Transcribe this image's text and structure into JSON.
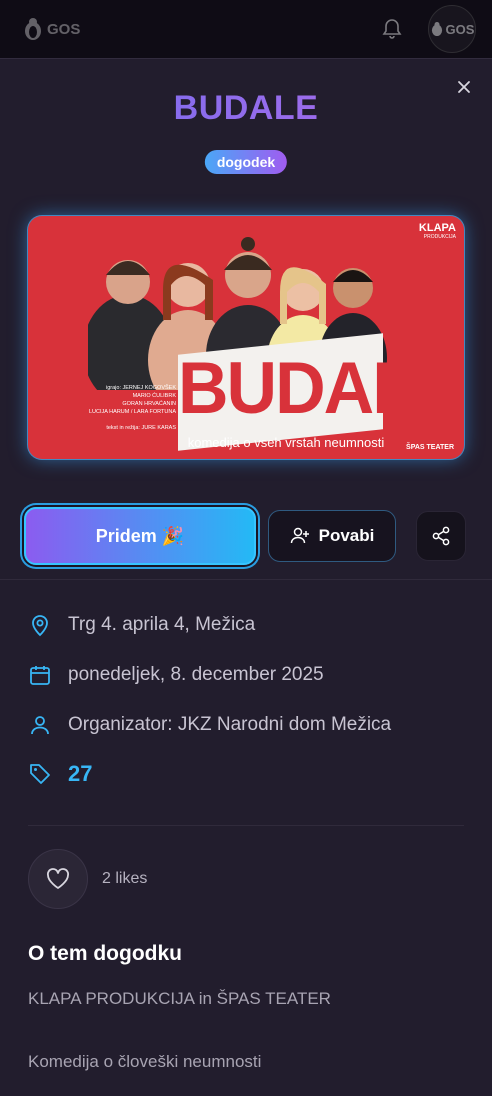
{
  "header": {
    "logo_text": "GOS",
    "avatar_text": "GOS"
  },
  "event": {
    "title": "BUDALE",
    "badge": "dogodek",
    "poster": {
      "brand": "KLAPA",
      "brand_sub": "PRODUKCIJA",
      "title": "BUDALE",
      "subtitle": "komedija o vseh vrstah neumnosti",
      "credits": [
        "igrajo: JERNEJ KOGOVŠEK",
        "MARIO ĆULIBRK",
        "GORAN HRVAĆANIN",
        "LUCIJA HARUM / LARA FORTUNA",
        "",
        "tekst in režija: JURE KARAS"
      ],
      "stamp": "ŠPAS TEATER"
    },
    "actions": {
      "attend_label": "Pridem 🎉",
      "invite_label": "Povabi"
    },
    "location": "Trg 4. aprila 4, Mežica",
    "date": "ponedeljek, 8. december 2025",
    "organizer": "Organizator: JKZ Narodni dom Mežica",
    "price": "27",
    "likes": "2 likes",
    "about_title": "O tem dogodku",
    "about_lines": [
      "KLAPA PRODUKCIJA in ŠPAS TEATER",
      "Komedija o človeški neumnosti"
    ]
  },
  "colors": {
    "accent": "#38b6f5",
    "primary_gradient_start": "#8b5cf0",
    "primary_gradient_end": "#24b9f5",
    "poster_red": "#d8323a"
  }
}
